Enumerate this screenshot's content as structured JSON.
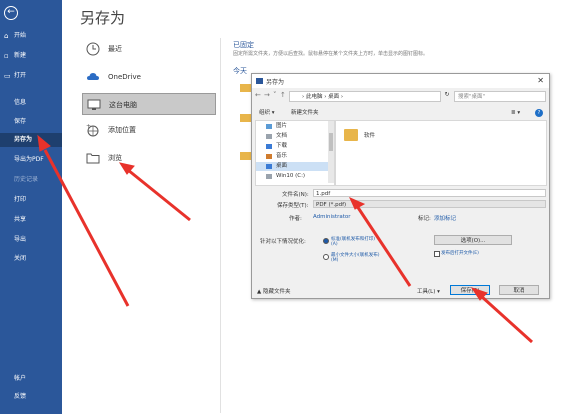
{
  "nav": {
    "back_glyph": "←",
    "items": [
      {
        "label": "开始",
        "glyph": "⌂"
      },
      {
        "label": "新建",
        "glyph": "▫"
      },
      {
        "label": "打开",
        "glyph": "▭"
      },
      {
        "label": "信息",
        "glyph": ""
      },
      {
        "label": "保存",
        "glyph": ""
      },
      {
        "label": "另存为",
        "glyph": ""
      },
      {
        "label": "导出为PDF",
        "glyph": ""
      },
      {
        "label": "历史记录",
        "glyph": ""
      },
      {
        "label": "打印",
        "glyph": ""
      },
      {
        "label": "共享",
        "glyph": ""
      },
      {
        "label": "导出",
        "glyph": ""
      },
      {
        "label": "关闭",
        "glyph": ""
      },
      {
        "label": "帐户",
        "glyph": ""
      },
      {
        "label": "反馈",
        "glyph": ""
      }
    ]
  },
  "page_title": "另存为",
  "locations": [
    {
      "label": "最近"
    },
    {
      "label": "OneDrive"
    },
    {
      "label": "这台电脑"
    },
    {
      "label": "添加位置"
    },
    {
      "label": "浏览"
    }
  ],
  "right": {
    "pinned_header": "已固定",
    "pinned_desc": "固定所需文件夹，方便以后查找。鼠标悬停在某个文件夹上方时，单击显示的图钉图标。",
    "today_header": "今天"
  },
  "dialog": {
    "title": "另存为",
    "close": "✕",
    "path": "› 此电脑 › 桌面 ›",
    "search_placeholder": "搜索\"桌面\"",
    "toolbar_organize": "组织 ▾",
    "toolbar_newfolder": "新建文件夹",
    "nav_items": [
      "图片",
      "文档",
      "下载",
      "音乐",
      "桌面",
      "Win10 (C:)"
    ],
    "file_folder": "软件",
    "filename_label": "文件名(N):",
    "filename_value": "1.pdf",
    "filetype_label": "保存类型(T):",
    "filetype_value": "PDF (*.pdf)",
    "author_label": "作者:",
    "author_value": "Administrator",
    "tags_label": "标记:",
    "tags_value": "添加标记",
    "optimize_label": "针对以下情况优化:",
    "opt1": "标准(联机发布和打印)(A)",
    "opt2": "最小文件大小(联机发布)(M)",
    "options_button": "选项(O)...",
    "open_after": "发布后打开文件(E)",
    "hide_folders": "▲ 隐藏文件夹",
    "tools": "工具(L) ▾",
    "save": "保存(S)",
    "cancel": "取消"
  },
  "colors": {
    "nav_bg": "#2b579a",
    "arrow": "#e8322b",
    "folder": "#e8b54a"
  }
}
